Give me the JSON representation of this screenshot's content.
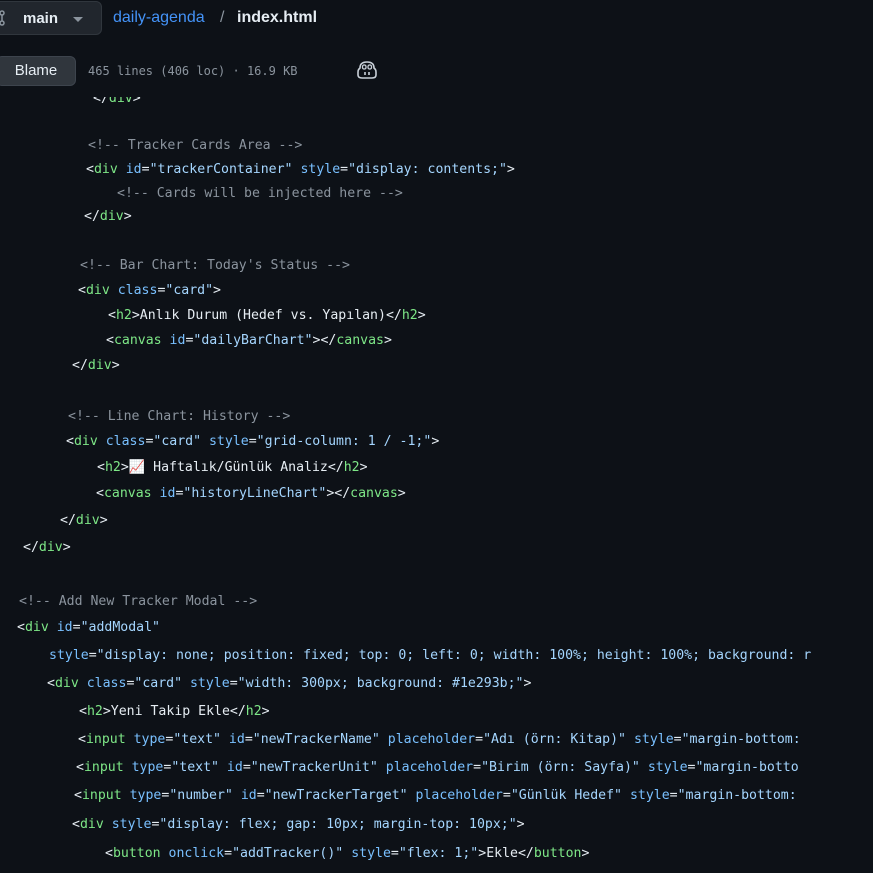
{
  "header": {
    "branch": "main",
    "repo": "daily-agenda",
    "separator": "/",
    "file": "index.html"
  },
  "file_bar": {
    "blame_label": "Blame",
    "file_info": "465 lines (406 loc) · 16.9 KB",
    "copilot_icon": "copilot-icon"
  },
  "code_lines": [
    "</div>",
    "",
    "<!-- Tracker Cards Area -->",
    "<div id=\"trackerContainer\" style=\"display: contents;\">",
    "<!-- Cards will be injected here -->",
    "</div>",
    "",
    "<!-- Bar Chart: Today's Status -->",
    "<div class=\"card\">",
    "<h2>Anlık Durum (Hedef vs. Yapılan)</h2>",
    "<canvas id=\"dailyBarChart\"></canvas>",
    "</div>",
    "",
    "<!-- Line Chart: History -->",
    "<div class=\"card\" style=\"grid-column: 1 / -1;\">",
    "<h2>📈 Haftalık/Günlük Analiz</h2>",
    "<canvas id=\"historyLineChart\"></canvas>",
    "</div>",
    "</div>",
    "",
    "<!-- Add New Tracker Modal -->",
    "<div id=\"addModal\"",
    "style=\"display: none; position: fixed; top: 0; left: 0; width: 100%; height: 100%; background: r",
    "<div class=\"card\" style=\"width: 300px; background: #1e293b;\">",
    "<h2>Yeni Takip Ekle</h2>",
    "<input type=\"text\" id=\"newTrackerName\" placeholder=\"Adı (örn: Kitap)\" style=\"margin-bottom:",
    "<input type=\"text\" id=\"newTrackerUnit\" placeholder=\"Birim (örn: Sayfa)\" style=\"margin-botto",
    "<input type=\"number\" id=\"newTrackerTarget\" placeholder=\"Günlük Hedef\" style=\"margin-bottom:",
    "<div style=\"display: flex; gap: 10px; margin-top: 10px;\">",
    "<button onclick=\"addTracker()\" style=\"flex: 1;\">Ekle</button>"
  ],
  "colors": {
    "background": "#0d1117",
    "tag": "#7ee787",
    "attribute": "#79c0ff",
    "string": "#a5d6ff",
    "comment": "#8b949e",
    "link": "#4493f8"
  }
}
